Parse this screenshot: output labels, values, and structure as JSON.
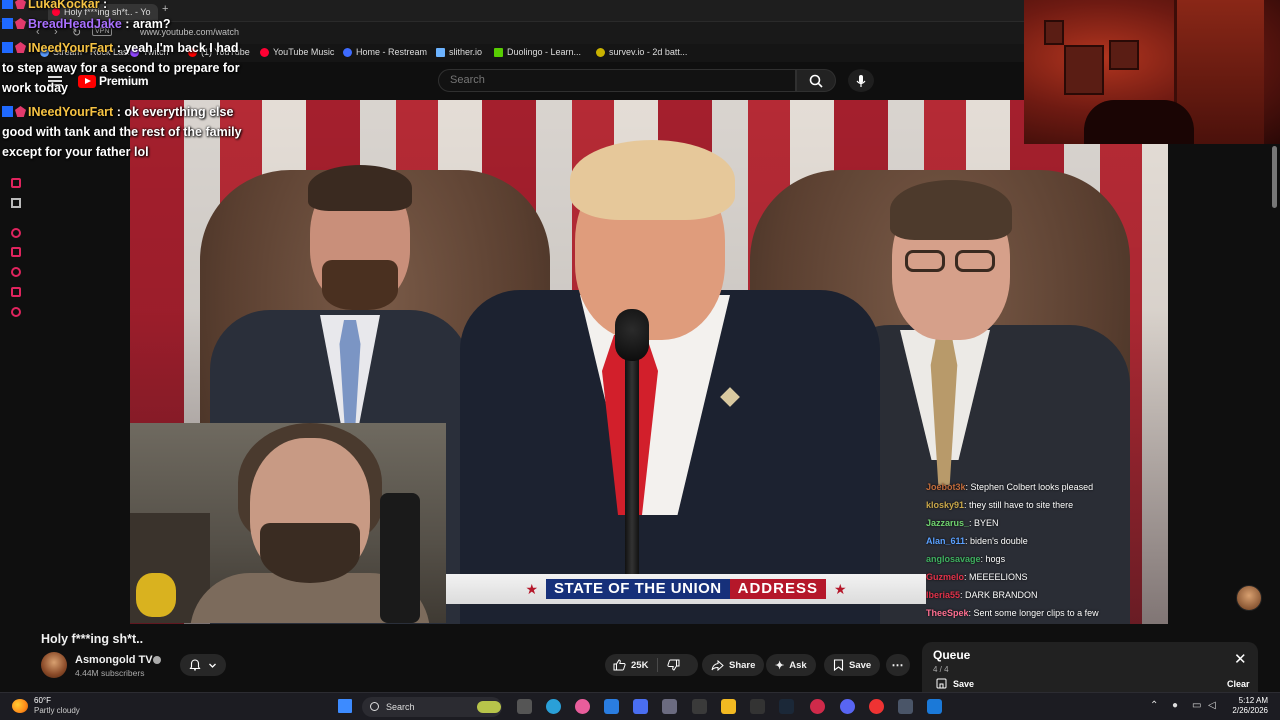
{
  "browser": {
    "tab_title": "Holy f***ing sh*t.. - Yo",
    "vpn_label": "VPN",
    "url": "www.youtube.com/watch",
    "bookmarks": [
      "Stream - Rock Las...",
      "Twitch",
      "(1) YouTube",
      "YouTube Music",
      "Home - Restream",
      "slither.io",
      "Duolingo - Learn...",
      "survev.io - 2d batt..."
    ]
  },
  "youtube": {
    "logo_text": "Premium",
    "search_placeholder": "Search"
  },
  "chat_left": [
    {
      "user": "LukaKockar",
      "text": ":",
      "color": "#f6c343"
    },
    {
      "user": "BreadHeadJake",
      "text": ": aram?",
      "color": "#a970ff"
    },
    {
      "user": "INeedYourFart",
      "text": ": yeah I'm back I had to step away for a second to prepare for work today",
      "color": "#f6c343"
    },
    {
      "user": "INeedYourFart",
      "text": ": ok everything else good with tank and the rest of the family except for your father lol",
      "color": "#f6c343"
    }
  ],
  "chat_right": [
    {
      "user": "Joebot3k",
      "text": "Stephen Colbert looks pleased",
      "color": "#c16b3b"
    },
    {
      "user": "klosky91",
      "text": "they still have to site there",
      "color": "#c9a74a"
    },
    {
      "user": "Jazzarus_",
      "text": "BYEN",
      "color": "#6fd36f"
    },
    {
      "user": "Alan_611",
      "text": "biden's double",
      "color": "#5aa0ff"
    },
    {
      "user": "anglosavage",
      "text": "hogs",
      "color": "#3fb060"
    },
    {
      "user": "Guzmelo",
      "text": "MEEEELIONS",
      "color": "#e0324a"
    },
    {
      "user": "Iberia55",
      "text": "DARK BRANDON",
      "color": "#e0324a"
    },
    {
      "user": "TheeSpek",
      "text": "Sent some longer clips to a few",
      "color": "#ff6f91"
    }
  ],
  "banner": {
    "part1": "STATE OF THE UNION",
    "part2": "ADDRESS"
  },
  "video": {
    "title": "Holy f***ing sh*t..",
    "channel": "Asmongold TV",
    "subscribers": "4.44M subscribers"
  },
  "actions": {
    "likes": "25K",
    "share": "Share",
    "ask": "Ask",
    "save": "Save"
  },
  "queue": {
    "title": "Queue",
    "count": "4 / 4",
    "save": "Save",
    "clear": "Clear"
  },
  "taskbar": {
    "temp": "60°F",
    "weather": "Partly cloudy",
    "search": "Search",
    "time": "5:12 AM",
    "date": "2/26/2026"
  },
  "colors": {
    "background": "#0f0f0f",
    "youtube_red": "#ff0000",
    "banner_blue": "#16307a",
    "banner_red": "#b5172a"
  }
}
